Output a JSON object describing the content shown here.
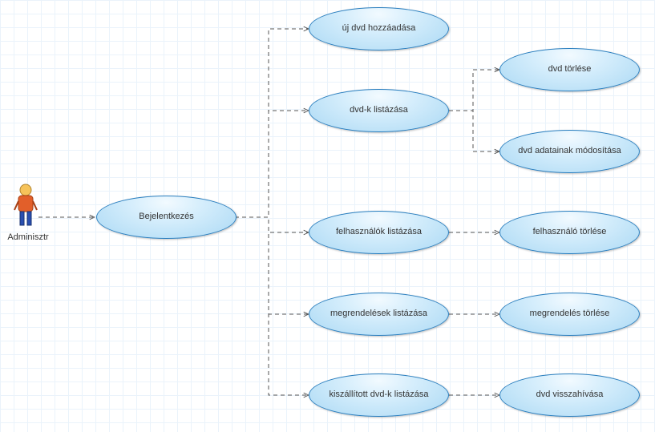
{
  "actor": {
    "label": "Adminisztr"
  },
  "nodes": {
    "login": {
      "label": "Bejelentkezés"
    },
    "addDvd": {
      "label": "új dvd hozzáadása"
    },
    "listDvds": {
      "label": "dvd-k  listázása"
    },
    "listUsers": {
      "label": "felhasználók listázása"
    },
    "listOrders": {
      "label": "megrendelések listázása"
    },
    "listDelivered": {
      "label": "kiszállított dvd-k listázása"
    },
    "deleteDvd": {
      "label": "dvd törlése"
    },
    "editDvd": {
      "label": "dvd adatainak módosítása"
    },
    "deleteUser": {
      "label": "felhasználó törlése"
    },
    "deleteOrder": {
      "label": "megrendelés törlése"
    },
    "recallDvd": {
      "label": "dvd visszahívása"
    }
  },
  "chart_data": {
    "type": "diagram",
    "diagram_type": "uml-use-case",
    "actors": [
      "Adminisztr"
    ],
    "use_cases": [
      "Bejelentkezés",
      "új dvd hozzáadása",
      "dvd-k  listázása",
      "felhasználók listázása",
      "megrendelések listázása",
      "kiszállított dvd-k listázása",
      "dvd törlése",
      "dvd adatainak módosítása",
      "felhasználó törlése",
      "megrendelés törlése",
      "dvd visszahívása"
    ],
    "edges": [
      {
        "from": "Adminisztr",
        "to": "Bejelentkezés",
        "style": "dashed-arrow"
      },
      {
        "from": "Bejelentkezés",
        "to": "új dvd hozzáadása",
        "style": "dashed-arrow"
      },
      {
        "from": "Bejelentkezés",
        "to": "dvd-k  listázása",
        "style": "dashed-arrow"
      },
      {
        "from": "Bejelentkezés",
        "to": "felhasználók listázása",
        "style": "dashed-arrow"
      },
      {
        "from": "Bejelentkezés",
        "to": "megrendelések listázása",
        "style": "dashed-arrow"
      },
      {
        "from": "Bejelentkezés",
        "to": "kiszállított dvd-k listázása",
        "style": "dashed-arrow"
      },
      {
        "from": "dvd-k  listázása",
        "to": "dvd törlése",
        "style": "dashed-arrow"
      },
      {
        "from": "dvd-k  listázása",
        "to": "dvd adatainak módosítása",
        "style": "dashed-arrow"
      },
      {
        "from": "felhasználók listázása",
        "to": "felhasználó törlése",
        "style": "dashed-arrow"
      },
      {
        "from": "megrendelések listázása",
        "to": "megrendelés törlése",
        "style": "dashed-arrow"
      },
      {
        "from": "kiszállított dvd-k listázása",
        "to": "dvd visszahívása",
        "style": "dashed-arrow"
      }
    ]
  }
}
